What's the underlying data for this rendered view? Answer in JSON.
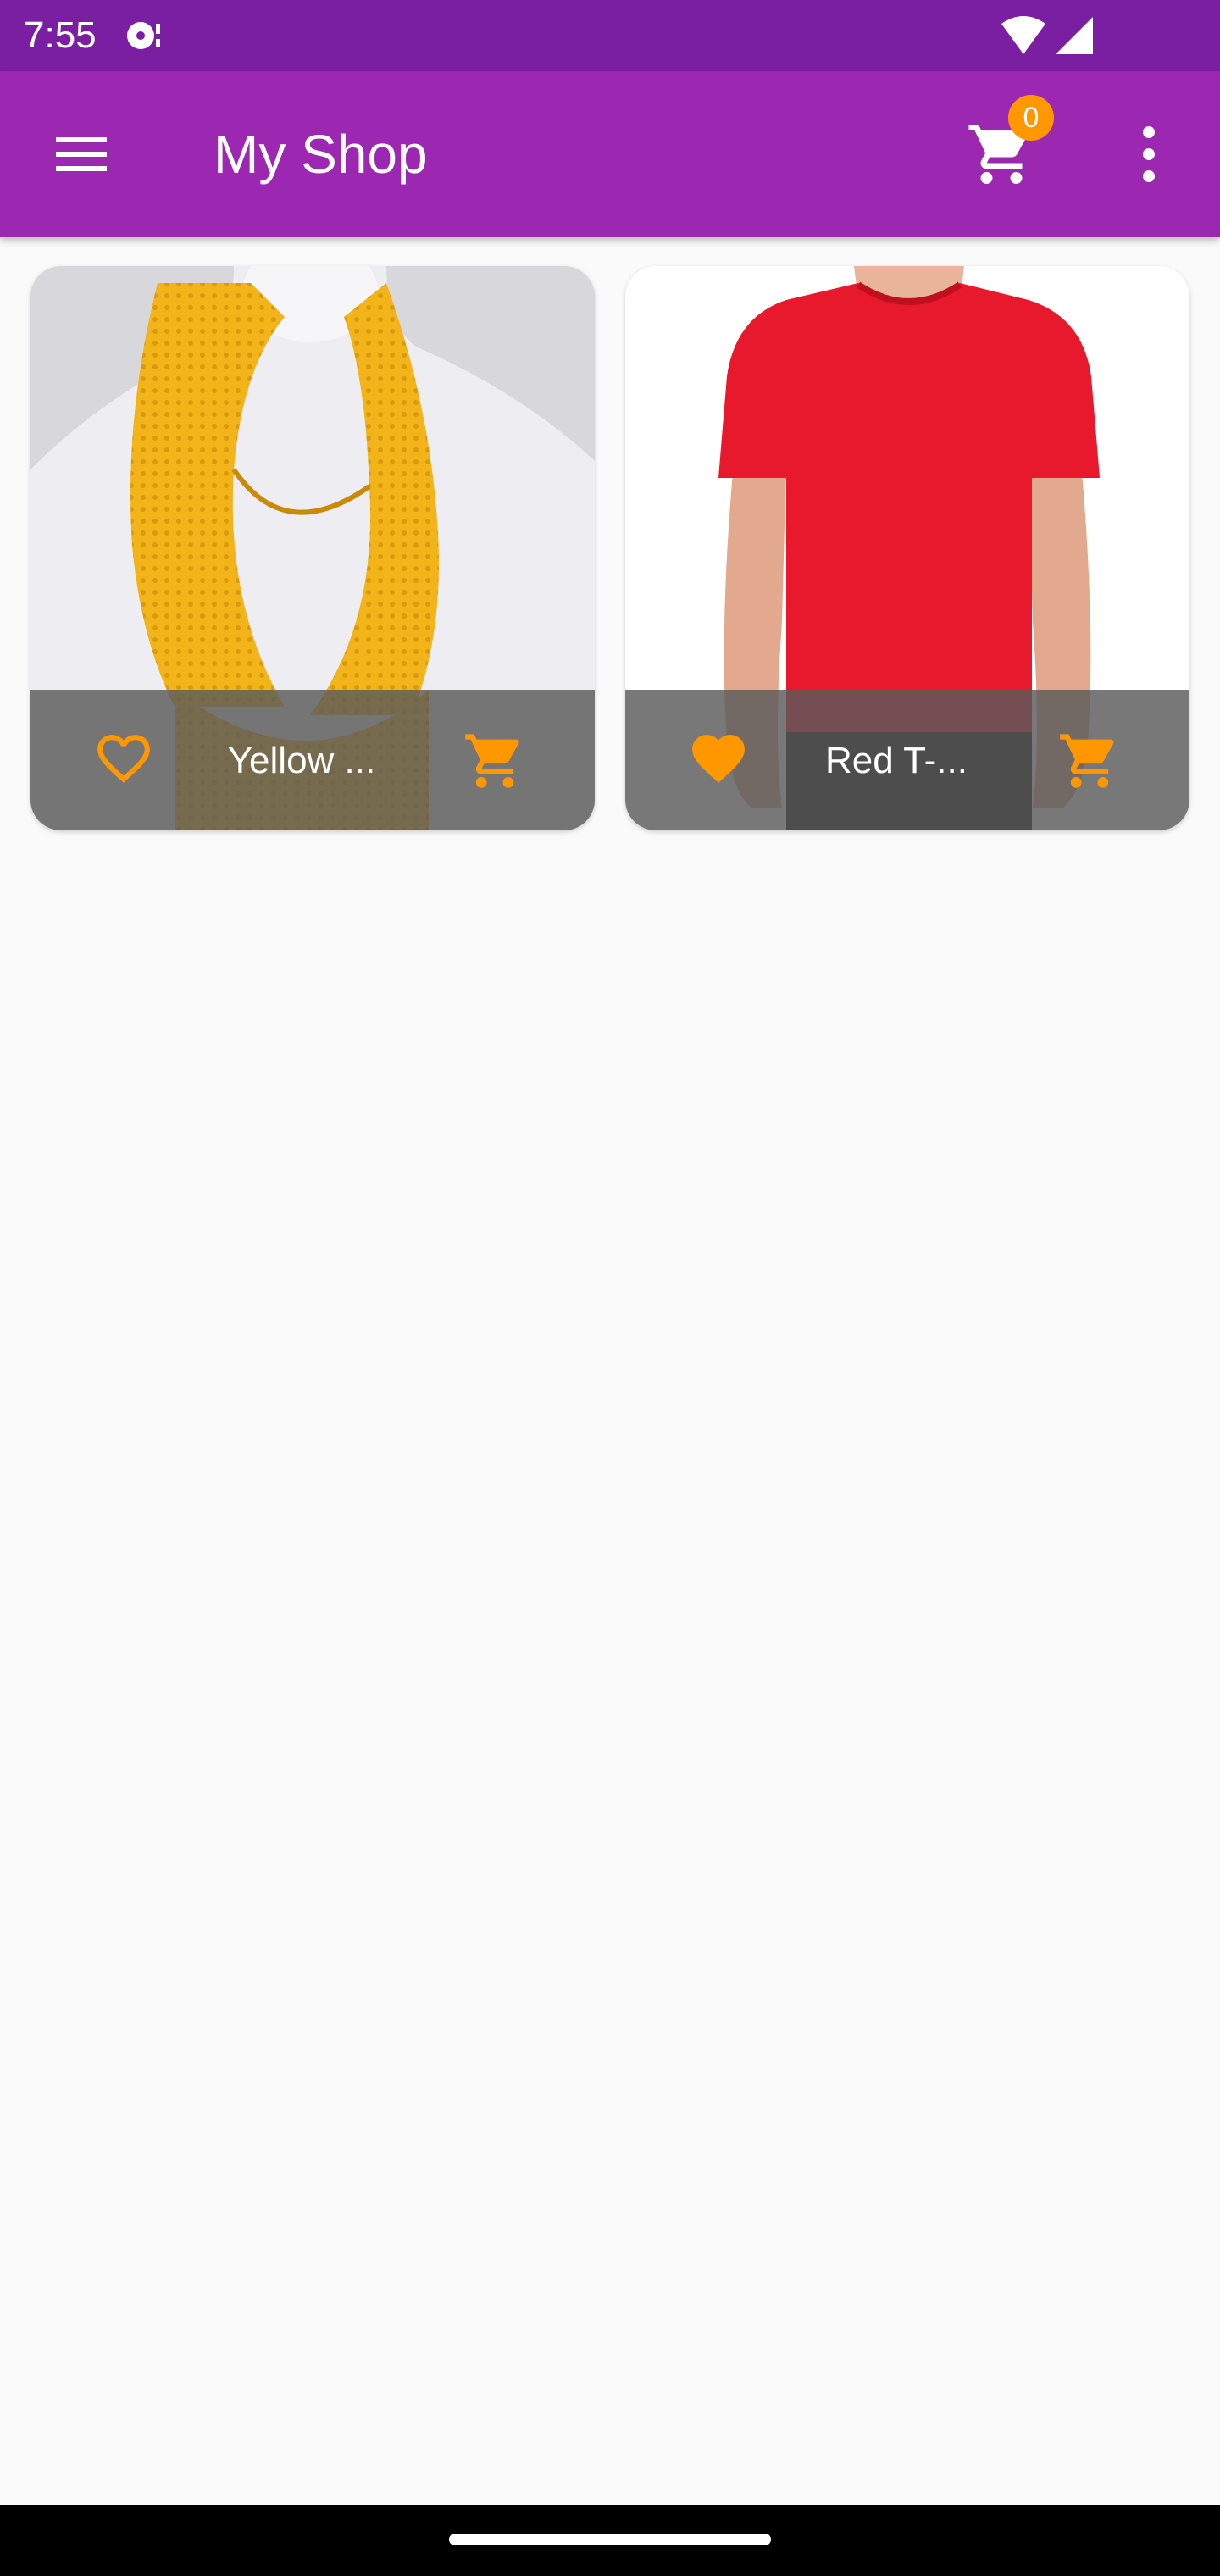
{
  "status_bar": {
    "time": "7:55",
    "icons": [
      "media-notification-icon",
      "wifi-icon",
      "cell-signal-icon"
    ]
  },
  "app_bar": {
    "title": "My Shop",
    "cart_count": "0",
    "icons": [
      "menu-icon",
      "cart-icon",
      "overflow-menu-icon"
    ]
  },
  "products": [
    {
      "name": "Yellow ...",
      "favorite": false,
      "image": "yellow-infinity-scarf",
      "icons": [
        "heart-outline-icon",
        "add-to-cart-icon"
      ]
    },
    {
      "name": "Red T-...",
      "favorite": true,
      "image": "red-tshirt",
      "icons": [
        "heart-filled-icon",
        "add-to-cart-icon"
      ]
    }
  ],
  "colors": {
    "status_bar": "#7b1fa2",
    "app_bar": "#9c27b0",
    "accent": "#ff9800",
    "background": "#fafafa"
  }
}
